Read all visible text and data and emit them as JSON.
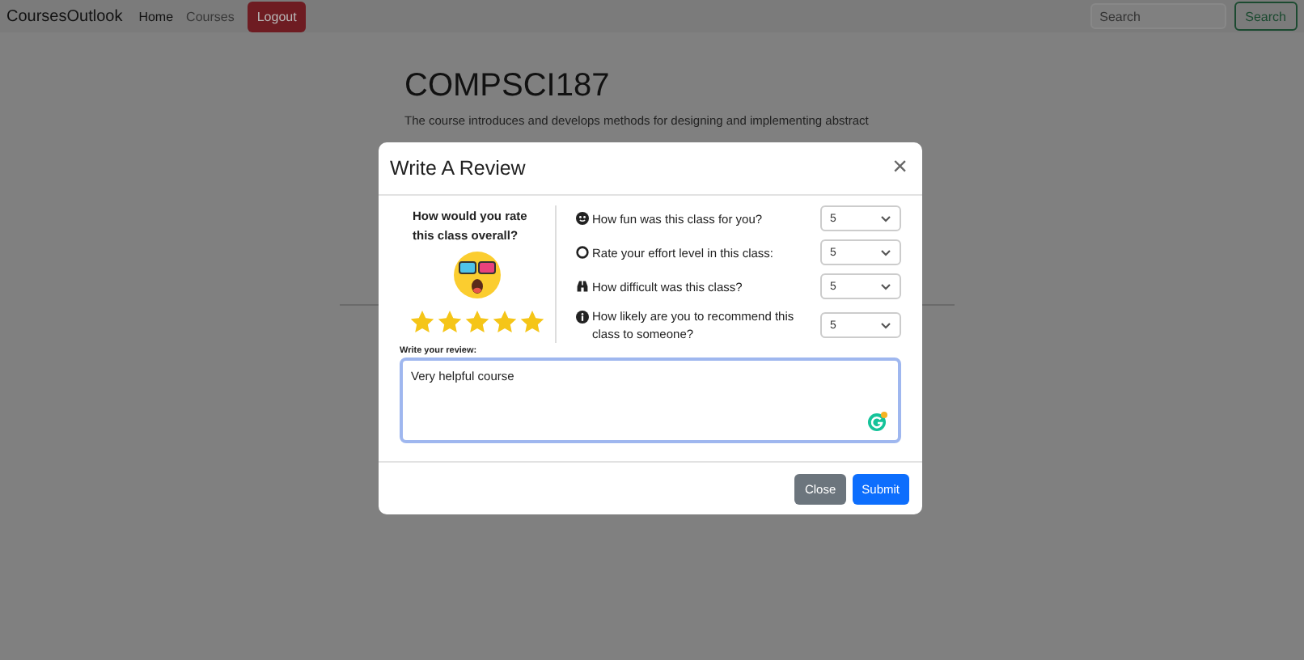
{
  "navbar": {
    "brand": "CoursesOutlook",
    "links": [
      {
        "label": "Home",
        "selected": true
      },
      {
        "label": "Courses",
        "selected": false
      }
    ],
    "logout": "Logout",
    "search": {
      "placeholder": "Search"
    },
    "search_button": "Search"
  },
  "course": {
    "title": "COMPSCI187",
    "description": [
      "The course introduces and develops methods for designing and implementing abstract"
    ]
  },
  "modal": {
    "title": "Write A Review",
    "close": "×",
    "overall": {
      "question": "How would you rate this class overall?",
      "stars": 5
    },
    "questions": [
      {
        "kind": "smile",
        "label": "How fun was this class for you?",
        "value": "5"
      },
      {
        "kind": "ring",
        "label": "Rate your effort level in this class:",
        "value": "5"
      },
      {
        "kind": "binoculars",
        "label": "How difficult was this class?",
        "value": "5"
      },
      {
        "kind": "info",
        "label": "How likely are you to recommend this class to someone?",
        "value": "5"
      }
    ],
    "review_label": "Write your review:",
    "review": "Very helpful course",
    "buttons": [
      {
        "kind": "secondary",
        "label": "Close"
      },
      {
        "kind": "primary",
        "label": "Submit"
      }
    ]
  }
}
